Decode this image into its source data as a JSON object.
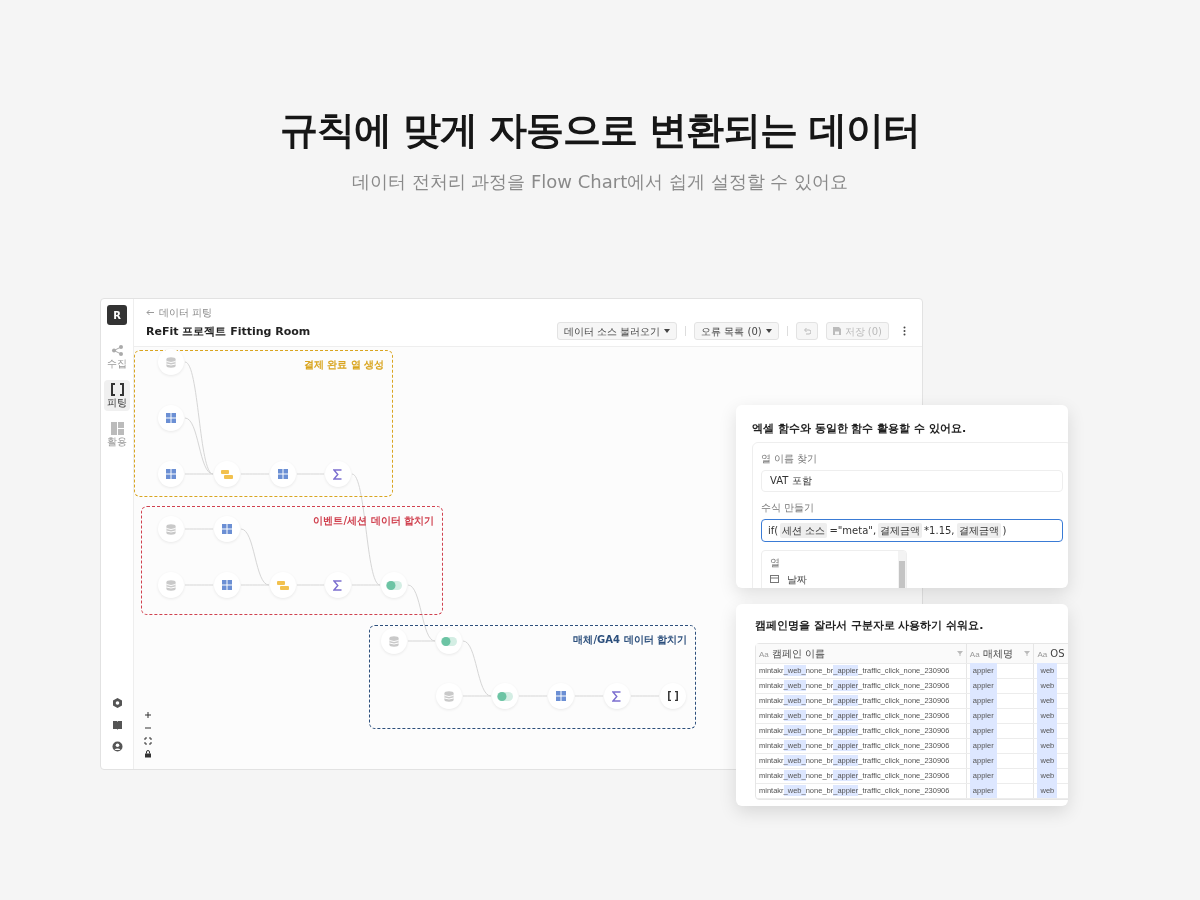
{
  "headline": "규칙에 맞게 자동으로 변환되는 데이터",
  "subtitle": "데이터 전처리 과정을 Flow Chart에서 쉽게 설정할 수 있어요",
  "app": {
    "logo": "R",
    "sidebar": [
      {
        "label": "수집",
        "kind": "share",
        "selected": false
      },
      {
        "label": "피팅",
        "kind": "brackets",
        "selected": true
      },
      {
        "label": "활용",
        "kind": "layout",
        "selected": false
      }
    ],
    "breadcrumb": "데이터 피팅",
    "title": "ReFit 프로젝트 Fitting Room",
    "toolbar": [
      {
        "kind": "dropdown",
        "label": "데이터 소스 불러오기",
        "disabled": false
      },
      {
        "kind": "dropdown",
        "label": "오류 목록 (0)",
        "disabled": false
      },
      {
        "kind": "undo",
        "disabled": true
      },
      {
        "kind": "save",
        "label": "저장 (0)",
        "disabled": true
      },
      {
        "kind": "more"
      }
    ],
    "groups": [
      {
        "title": "결제 완료 열 생성",
        "color": "#d9a520",
        "nodes": [
          {
            "kind": "db"
          },
          {
            "kind": "grid"
          },
          {
            "kind": "grid"
          },
          {
            "kind": "union"
          },
          {
            "kind": "grid"
          },
          {
            "kind": "sigma"
          }
        ]
      },
      {
        "title": "이벤트/세션 데이터 합치기",
        "color": "#d0414f",
        "nodes": [
          {
            "kind": "db"
          },
          {
            "kind": "grid"
          },
          {
            "kind": "db"
          },
          {
            "kind": "grid"
          },
          {
            "kind": "union"
          },
          {
            "kind": "sigma"
          },
          {
            "kind": "toggle"
          }
        ]
      },
      {
        "title": "매체/GA4 데이터 합치기",
        "color": "#2c4f7c",
        "nodes": [
          {
            "kind": "db"
          },
          {
            "kind": "toggle"
          },
          {
            "kind": "db"
          },
          {
            "kind": "toggle"
          },
          {
            "kind": "grid"
          },
          {
            "kind": "sigma"
          },
          {
            "kind": "brackets"
          }
        ]
      }
    ]
  },
  "formula_panel": {
    "heading": "엑셀 함수와 동일한 함수 활용할 수 있어요.",
    "name_label": "열 이름 찾기",
    "name_value": "VAT 포함",
    "formula_label": "수식 만들기",
    "formula": [
      {
        "kind": "text",
        "text": "if("
      },
      {
        "kind": "chip",
        "text": "세션 소스"
      },
      {
        "kind": "text",
        "text": "=\"meta\","
      },
      {
        "kind": "chip",
        "text": "결제금액"
      },
      {
        "kind": "text",
        "text": "*1.15,"
      },
      {
        "kind": "chip",
        "text": "결제금액"
      },
      {
        "kind": "text",
        "text": ")"
      }
    ],
    "list_header": "열",
    "list_items": [
      "날짜"
    ]
  },
  "table_panel": {
    "heading": "캠페인명을 잘라서 구분자로 사용하기 쉬워요.",
    "columns": [
      {
        "type_label": "Aa",
        "label": "캠페인 이름",
        "filter": true
      },
      {
        "type_label": "Aa",
        "label": "매체명",
        "filter": true
      },
      {
        "type_label": "Aa",
        "label": "OS"
      }
    ],
    "rows": [
      {
        "campaign": [
          {
            "text": "mintakr",
            "highlighted": false
          },
          {
            "text": "_web_",
            "highlighted": true
          },
          {
            "text": "none_br",
            "highlighted": false
          },
          {
            "text": "_appier",
            "highlighted": true
          },
          {
            "text": "_traffic_click_none_230906",
            "highlighted": false
          }
        ],
        "media": {
          "text": "appier",
          "highlighted": true
        },
        "os": {
          "text": "web",
          "highlighted": true
        }
      },
      {
        "campaign": [
          {
            "text": "mintakr",
            "highlighted": false
          },
          {
            "text": "_web_",
            "highlighted": true
          },
          {
            "text": "none_br",
            "highlighted": false
          },
          {
            "text": "_appier",
            "highlighted": true
          },
          {
            "text": "_traffic_click_none_230906",
            "highlighted": false
          }
        ],
        "media": {
          "text": "appier",
          "highlighted": true
        },
        "os": {
          "text": "web",
          "highlighted": true
        }
      },
      {
        "campaign": [
          {
            "text": "mintakr",
            "highlighted": false
          },
          {
            "text": "_web_",
            "highlighted": true
          },
          {
            "text": "none_br",
            "highlighted": false
          },
          {
            "text": "_appier",
            "highlighted": true
          },
          {
            "text": "_traffic_click_none_230906",
            "highlighted": false
          }
        ],
        "media": {
          "text": "appier",
          "highlighted": true
        },
        "os": {
          "text": "web",
          "highlighted": true
        }
      },
      {
        "campaign": [
          {
            "text": "mintakr",
            "highlighted": false
          },
          {
            "text": "_web_",
            "highlighted": true
          },
          {
            "text": "none_br",
            "highlighted": false
          },
          {
            "text": "_appier",
            "highlighted": true
          },
          {
            "text": "_traffic_click_none_230906",
            "highlighted": false
          }
        ],
        "media": {
          "text": "appier",
          "highlighted": true
        },
        "os": {
          "text": "web",
          "highlighted": true
        }
      },
      {
        "campaign": [
          {
            "text": "mintakr",
            "highlighted": false
          },
          {
            "text": "_web_",
            "highlighted": true
          },
          {
            "text": "none_br",
            "highlighted": false
          },
          {
            "text": "_appier",
            "highlighted": true
          },
          {
            "text": "_traffic_click_none_230906",
            "highlighted": false
          }
        ],
        "media": {
          "text": "appier",
          "highlighted": true
        },
        "os": {
          "text": "web",
          "highlighted": true
        }
      },
      {
        "campaign": [
          {
            "text": "mintakr",
            "highlighted": false
          },
          {
            "text": "_web_",
            "highlighted": true
          },
          {
            "text": "none_br",
            "highlighted": false
          },
          {
            "text": "_appier",
            "highlighted": true
          },
          {
            "text": "_traffic_click_none_230906",
            "highlighted": false
          }
        ],
        "media": {
          "text": "appier",
          "highlighted": true
        },
        "os": {
          "text": "web",
          "highlighted": true
        }
      },
      {
        "campaign": [
          {
            "text": "mintakr",
            "highlighted": false
          },
          {
            "text": "_web_",
            "highlighted": true
          },
          {
            "text": "none_br",
            "highlighted": false
          },
          {
            "text": "_appier",
            "highlighted": true
          },
          {
            "text": "_traffic_click_none_230906",
            "highlighted": false
          }
        ],
        "media": {
          "text": "appier",
          "highlighted": true
        },
        "os": {
          "text": "web",
          "highlighted": true
        }
      },
      {
        "campaign": [
          {
            "text": "mintakr",
            "highlighted": false
          },
          {
            "text": "_web_",
            "highlighted": true
          },
          {
            "text": "none_br",
            "highlighted": false
          },
          {
            "text": "_appier",
            "highlighted": true
          },
          {
            "text": "_traffic_click_none_230906",
            "highlighted": false
          }
        ],
        "media": {
          "text": "appier",
          "highlighted": true
        },
        "os": {
          "text": "web",
          "highlighted": true
        }
      },
      {
        "campaign": [
          {
            "text": "mintakr",
            "highlighted": false
          },
          {
            "text": "_web_",
            "highlighted": true
          },
          {
            "text": "none_br",
            "highlighted": false
          },
          {
            "text": "_appier",
            "highlighted": true
          },
          {
            "text": "_traffic_click_none_230906",
            "highlighted": false
          }
        ],
        "media": {
          "text": "appier",
          "highlighted": true
        },
        "os": {
          "text": "web",
          "highlighted": true
        }
      }
    ]
  }
}
